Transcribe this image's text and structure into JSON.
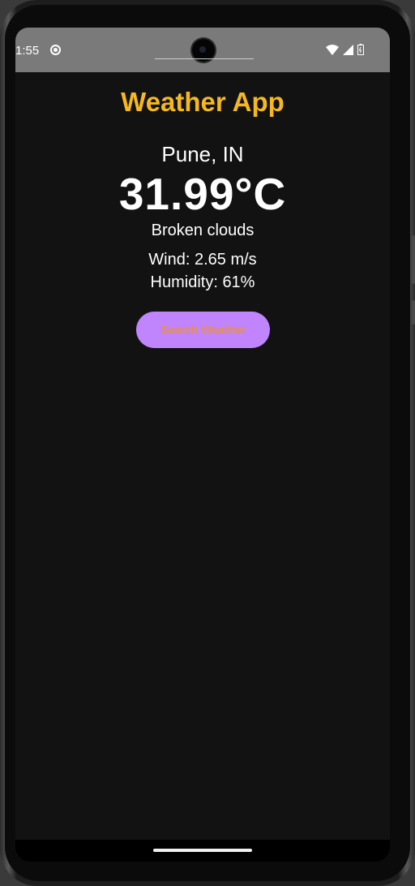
{
  "status_bar": {
    "time": "1:55",
    "icons": [
      "notification-dot-icon",
      "wifi-icon",
      "signal-icon",
      "battery-icon"
    ]
  },
  "app": {
    "title": "Weather App",
    "title_color": "#f5b820"
  },
  "weather": {
    "city": "Pune, IN",
    "temperature": "31.99°C",
    "condition": "Broken clouds",
    "wind": "Wind: 2.65 m/s",
    "humidity": "Humidity: 61%"
  },
  "actions": {
    "search_label": "Search Weather",
    "button_color": "#c084fc",
    "button_text_color": "#e8904a"
  }
}
